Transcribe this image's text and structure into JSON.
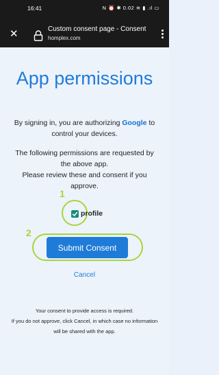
{
  "status_bar": {
    "time": "16:41",
    "icons_text": "N ⏰ ✱ 0.02 ≋ ▮ .ıl ▭"
  },
  "url_bar": {
    "title": "Custom consent page - Consent",
    "domain": "homplex.com",
    "icons": [
      "close-icon",
      "lock-icon",
      "overflow-menu-icon"
    ]
  },
  "page": {
    "heading": "App permissions",
    "intro_prefix": "By signing in, you are authorizing ",
    "intro_brand": "Google",
    "intro_suffix": " to control your devices.",
    "permissions_text": "The following permissions are requested by the above app.",
    "review_text": "Please review these and consent if you approve.",
    "permission_label": "profile",
    "permission_checked": true,
    "submit_label": "Submit Consent",
    "cancel_label": "Cancel",
    "footer_line1": "Your consent to provide access is required.",
    "footer_line2": "If you do not approve, click Cancel, in which case no information will be shared with the app."
  },
  "annotations": {
    "marker_1": "1",
    "marker_2": "2",
    "highlight_color": "#a6d63a"
  },
  "colors": {
    "accent": "#1f7bd8",
    "checkbox": "#1a8a7a",
    "background": "#edf3fb"
  }
}
